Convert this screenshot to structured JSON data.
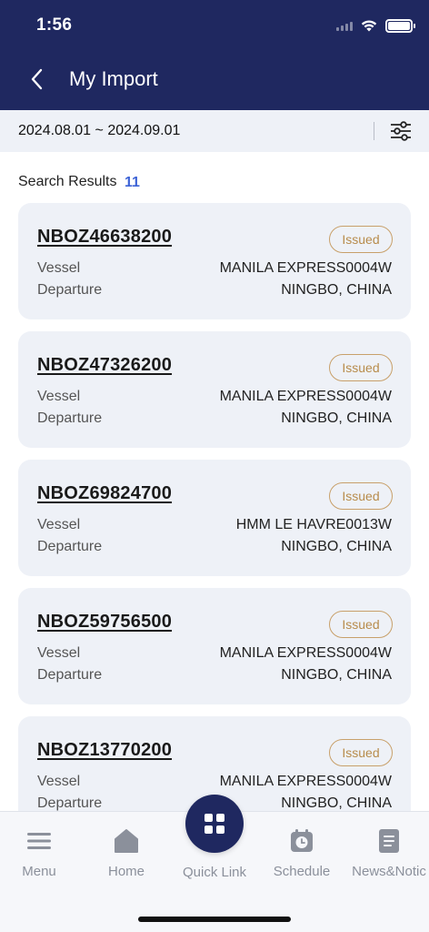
{
  "status": {
    "time": "1:56"
  },
  "header": {
    "title": "My Import"
  },
  "filter": {
    "date_range": "2024.08.01 ~ 2024.09.01"
  },
  "results": {
    "label": "Search Results",
    "count": "11"
  },
  "cards": [
    {
      "number": "NBOZ46638200",
      "status": "Issued",
      "vessel_label": "Vessel",
      "vessel": "MANILA EXPRESS0004W",
      "departure_label": "Departure",
      "departure": "NINGBO, CHINA"
    },
    {
      "number": "NBOZ47326200",
      "status": "Issued",
      "vessel_label": "Vessel",
      "vessel": "MANILA EXPRESS0004W",
      "departure_label": "Departure",
      "departure": "NINGBO, CHINA"
    },
    {
      "number": "NBOZ69824700",
      "status": "Issued",
      "vessel_label": "Vessel",
      "vessel": "HMM LE HAVRE0013W",
      "departure_label": "Departure",
      "departure": "NINGBO, CHINA"
    },
    {
      "number": "NBOZ59756500",
      "status": "Issued",
      "vessel_label": "Vessel",
      "vessel": "MANILA EXPRESS0004W",
      "departure_label": "Departure",
      "departure": "NINGBO, CHINA"
    },
    {
      "number": "NBOZ13770200",
      "status": "Issued",
      "vessel_label": "Vessel",
      "vessel": "MANILA EXPRESS0004W",
      "departure_label": "Departure",
      "departure": "NINGBO, CHINA"
    }
  ],
  "nav": {
    "menu": "Menu",
    "home": "Home",
    "quick_link": "Quick Link",
    "schedule": "Schedule",
    "news": "News&Notic"
  },
  "colors": {
    "primary": "#1f2860",
    "accent_count": "#3d63d6",
    "badge": "#c8a06a",
    "card_bg": "#eef1f7"
  },
  "icons": {
    "back": "chevron-left-icon",
    "filter": "sliders-icon",
    "menu": "hamburger-icon",
    "home": "home-icon",
    "quick_link": "grid-icon",
    "schedule": "clock-icon",
    "news": "document-icon"
  }
}
